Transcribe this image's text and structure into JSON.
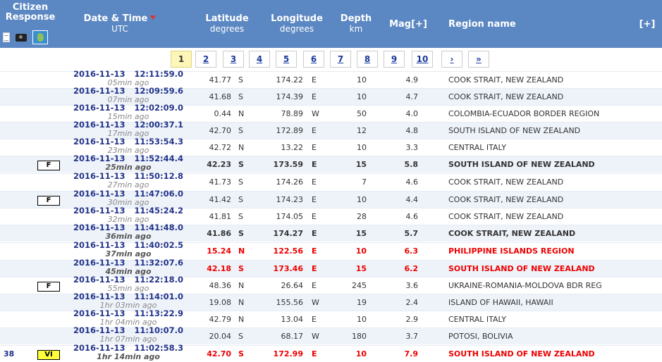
{
  "header": {
    "citizen": "Citizen",
    "response": "Response",
    "datetime": "Date & Time",
    "utc": "UTC",
    "latitude": "Latitude",
    "lat_unit": "degrees",
    "longitude": "Longitude",
    "lon_unit": "degrees",
    "depth": "Depth",
    "depth_unit": "km",
    "mag": "Mag[+]",
    "region": "Region name",
    "expand": "[+]",
    "icons": [
      "document-icon",
      "camera-icon",
      "map-icon"
    ]
  },
  "pager": {
    "pages": [
      "1",
      "2",
      "3",
      "4",
      "5",
      "6",
      "7",
      "8",
      "9",
      "10"
    ],
    "current": "1",
    "next": "›",
    "last": "»"
  },
  "colors": {
    "header_bg": "#5B87C2",
    "alt_row": "#EEF3FA",
    "link": "#22338A",
    "alert": "#E00000",
    "badge_vi": "#FFFF3A"
  },
  "events": [
    {
      "date": "2016-11-13",
      "time": "12:11:59.0",
      "ago": "05min ago",
      "lat": "41.77",
      "ns": "S",
      "lon": "174.22",
      "ew": "E",
      "depth": "10",
      "mag": "4.9",
      "region": "COOK STRAIT, NEW ZEALAND",
      "badge": "",
      "count": "",
      "style": "normal",
      "alt": false
    },
    {
      "date": "2016-11-13",
      "time": "12:09:59.6",
      "ago": "07min ago",
      "lat": "41.68",
      "ns": "S",
      "lon": "174.39",
      "ew": "E",
      "depth": "10",
      "mag": "4.7",
      "region": "COOK STRAIT, NEW ZEALAND",
      "badge": "",
      "count": "",
      "style": "normal",
      "alt": true
    },
    {
      "date": "2016-11-13",
      "time": "12:02:09.0",
      "ago": "15min ago",
      "lat": "0.44",
      "ns": "N",
      "lon": "78.89",
      "ew": "W",
      "depth": "50",
      "mag": "4.0",
      "region": "COLOMBIA-ECUADOR BORDER REGION",
      "badge": "",
      "count": "",
      "style": "normal",
      "alt": false
    },
    {
      "date": "2016-11-13",
      "time": "12:00:37.1",
      "ago": "17min ago",
      "lat": "42.70",
      "ns": "S",
      "lon": "172.89",
      "ew": "E",
      "depth": "12",
      "mag": "4.8",
      "region": "SOUTH ISLAND OF NEW ZEALAND",
      "badge": "",
      "count": "",
      "style": "normal",
      "alt": true
    },
    {
      "date": "2016-11-13",
      "time": "11:53:54.3",
      "ago": "23min ago",
      "lat": "42.72",
      "ns": "N",
      "lon": "13.22",
      "ew": "E",
      "depth": "10",
      "mag": "3.3",
      "region": "CENTRAL ITALY",
      "badge": "",
      "count": "",
      "style": "normal",
      "alt": false
    },
    {
      "date": "2016-11-13",
      "time": "11:52:44.4",
      "ago": "25min ago",
      "lat": "42.23",
      "ns": "S",
      "lon": "173.59",
      "ew": "E",
      "depth": "15",
      "mag": "5.8",
      "region": "SOUTH ISLAND OF NEW ZEALAND",
      "badge": "F",
      "count": "",
      "style": "bold",
      "alt": true
    },
    {
      "date": "2016-11-13",
      "time": "11:50:12.8",
      "ago": "27min ago",
      "lat": "41.73",
      "ns": "S",
      "lon": "174.26",
      "ew": "E",
      "depth": "7",
      "mag": "4.6",
      "region": "COOK STRAIT, NEW ZEALAND",
      "badge": "",
      "count": "",
      "style": "normal",
      "alt": false
    },
    {
      "date": "2016-11-13",
      "time": "11:47:06.0",
      "ago": "30min ago",
      "lat": "41.42",
      "ns": "S",
      "lon": "174.23",
      "ew": "E",
      "depth": "10",
      "mag": "4.4",
      "region": "COOK STRAIT, NEW ZEALAND",
      "badge": "F",
      "count": "",
      "style": "normal",
      "alt": true
    },
    {
      "date": "2016-11-13",
      "time": "11:45:24.2",
      "ago": "32min ago",
      "lat": "41.81",
      "ns": "S",
      "lon": "174.05",
      "ew": "E",
      "depth": "28",
      "mag": "4.6",
      "region": "COOK STRAIT, NEW ZEALAND",
      "badge": "",
      "count": "",
      "style": "normal",
      "alt": false
    },
    {
      "date": "2016-11-13",
      "time": "11:41:48.0",
      "ago": "36min ago",
      "lat": "41.86",
      "ns": "S",
      "lon": "174.27",
      "ew": "E",
      "depth": "15",
      "mag": "5.7",
      "region": "COOK STRAIT, NEW ZEALAND",
      "badge": "",
      "count": "",
      "style": "bold",
      "alt": true
    },
    {
      "date": "2016-11-13",
      "time": "11:40:02.5",
      "ago": "37min ago",
      "lat": "15.24",
      "ns": "N",
      "lon": "122.56",
      "ew": "E",
      "depth": "10",
      "mag": "6.3",
      "region": "PHILIPPINE ISLANDS REGION",
      "badge": "",
      "count": "",
      "style": "red",
      "alt": false
    },
    {
      "date": "2016-11-13",
      "time": "11:32:07.6",
      "ago": "45min ago",
      "lat": "42.18",
      "ns": "S",
      "lon": "173.46",
      "ew": "E",
      "depth": "15",
      "mag": "6.2",
      "region": "SOUTH ISLAND OF NEW ZEALAND",
      "badge": "",
      "count": "",
      "style": "red",
      "alt": true
    },
    {
      "date": "2016-11-13",
      "time": "11:22:18.0",
      "ago": "55min ago",
      "lat": "48.36",
      "ns": "N",
      "lon": "26.64",
      "ew": "E",
      "depth": "245",
      "mag": "3.6",
      "region": "UKRAINE-ROMANIA-MOLDOVA BDR REG",
      "badge": "F",
      "count": "",
      "style": "normal",
      "alt": false
    },
    {
      "date": "2016-11-13",
      "time": "11:14:01.0",
      "ago": "1hr 03min ago",
      "lat": "19.08",
      "ns": "N",
      "lon": "155.56",
      "ew": "W",
      "depth": "19",
      "mag": "2.4",
      "region": "ISLAND OF HAWAII, HAWAII",
      "badge": "",
      "count": "",
      "style": "normal",
      "alt": true
    },
    {
      "date": "2016-11-13",
      "time": "11:13:22.9",
      "ago": "1hr 04min ago",
      "lat": "42.79",
      "ns": "N",
      "lon": "13.04",
      "ew": "E",
      "depth": "10",
      "mag": "2.9",
      "region": "CENTRAL ITALY",
      "badge": "",
      "count": "",
      "style": "normal",
      "alt": false
    },
    {
      "date": "2016-11-13",
      "time": "11:10:07.0",
      "ago": "1hr 07min ago",
      "lat": "20.04",
      "ns": "S",
      "lon": "68.17",
      "ew": "W",
      "depth": "180",
      "mag": "3.7",
      "region": "POTOSI, BOLIVIA",
      "badge": "",
      "count": "",
      "style": "normal",
      "alt": true
    },
    {
      "date": "2016-11-13",
      "time": "11:02:58.3",
      "ago": "1hr 14min ago",
      "lat": "42.70",
      "ns": "S",
      "lon": "172.99",
      "ew": "E",
      "depth": "10",
      "mag": "7.9",
      "region": "SOUTH ISLAND OF NEW ZEALAND",
      "badge": "VI",
      "count": "38",
      "style": "red",
      "alt": false
    }
  ]
}
